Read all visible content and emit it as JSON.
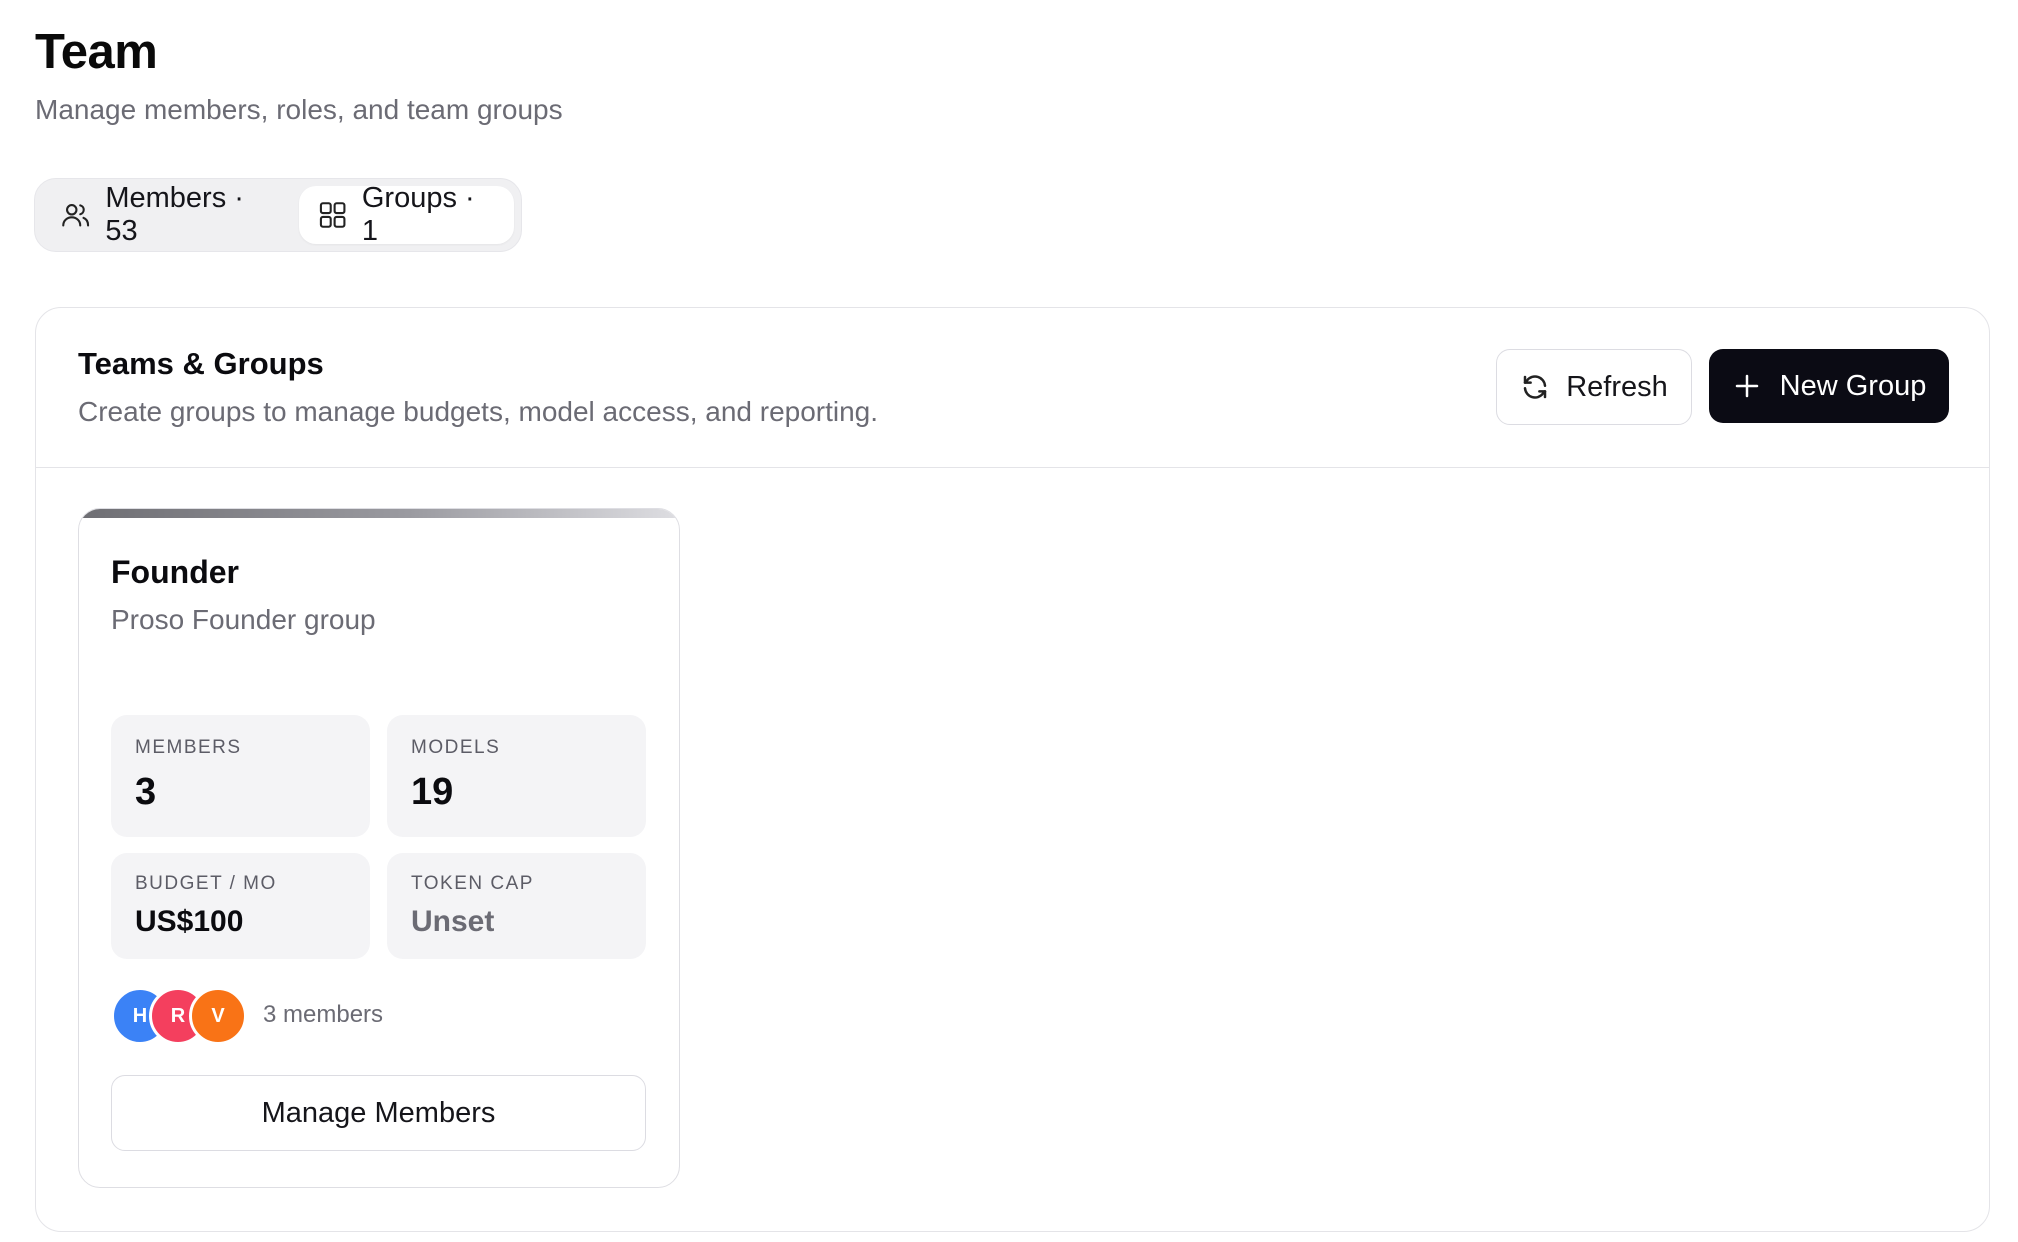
{
  "page": {
    "title": "Team",
    "subtitle": "Manage members, roles, and team groups"
  },
  "tabs": [
    {
      "label": "Members · 53",
      "icon": "users-icon",
      "active": false
    },
    {
      "label": "Groups · 1",
      "icon": "grid-icon",
      "active": true
    }
  ],
  "panel": {
    "title": "Teams & Groups",
    "description": "Create groups to manage budgets, model access, and reporting.",
    "refresh_label": "Refresh",
    "new_group_label": "New Group"
  },
  "groups": [
    {
      "name": "Founder",
      "description": "Proso Founder group",
      "stats": {
        "members": {
          "label": "MEMBERS",
          "value": "3"
        },
        "models": {
          "label": "MODELS",
          "value": "19"
        },
        "budget": {
          "label": "BUDGET / MO",
          "value": "US$100"
        },
        "token_cap": {
          "label": "TOKEN CAP",
          "value": "Unset"
        }
      },
      "avatars": [
        {
          "initial": "H",
          "color": "#3b82f6"
        },
        {
          "initial": "R",
          "color": "#f43f5e"
        },
        {
          "initial": "V",
          "color": "#f97316"
        }
      ],
      "members_text": "3 members",
      "manage_label": "Manage Members"
    }
  ],
  "colors": {
    "primary_button": "#0b0b14",
    "muted_text": "#6b6b74",
    "stat_background": "#f4f4f6"
  }
}
